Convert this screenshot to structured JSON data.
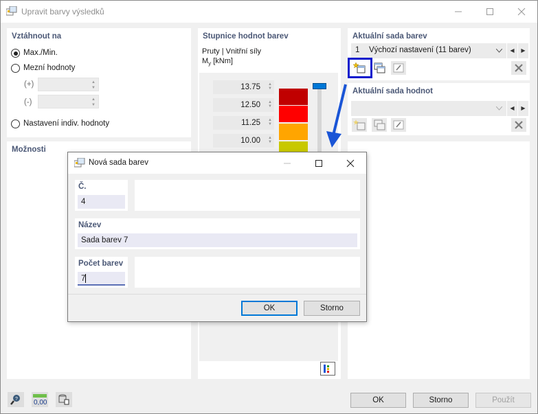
{
  "window": {
    "title": "Upravit barvy výsledků"
  },
  "refer": {
    "title": "Vztáhnout na",
    "options": [
      "Max./Min.",
      "Mezní hodnoty",
      "Nastavení indiv. hodnoty"
    ],
    "plus_label": "(+)",
    "minus_label": "(-)"
  },
  "options_panel": {
    "title": "Možnosti"
  },
  "scale": {
    "title": "Stupnice hodnot barev",
    "subtitle": "Pruty | Vnitřní síly",
    "unit_symbol": "M",
    "unit_sub": "y",
    "unit_suffix": " [kNm]",
    "values": [
      "13.75",
      "12.50",
      "11.25",
      "10.00"
    ],
    "colors": [
      "#c00000",
      "#ff0000",
      "#ffa500",
      "#c8c800"
    ]
  },
  "color_set": {
    "title": "Aktuální sada barev",
    "number": "1",
    "name": "Výchozí nastavení (11 barev)"
  },
  "value_set": {
    "title": "Aktuální sada hodnot"
  },
  "footer": {
    "ok": "OK",
    "cancel": "Storno",
    "apply": "Použít",
    "zero_value": "0,00"
  },
  "dialog": {
    "title": "Nová sada barev",
    "no_label": "Č.",
    "no_value": "4",
    "name_label": "Název",
    "name_value": "Sada barev 7",
    "count_label": "Počet barev",
    "count_value": "7",
    "ok": "OK",
    "cancel": "Storno"
  },
  "colors": {
    "accent": "#0078d7",
    "highlight": "#0a1acd",
    "arrow": "#1a55d6",
    "section_title": "#4b5876"
  }
}
